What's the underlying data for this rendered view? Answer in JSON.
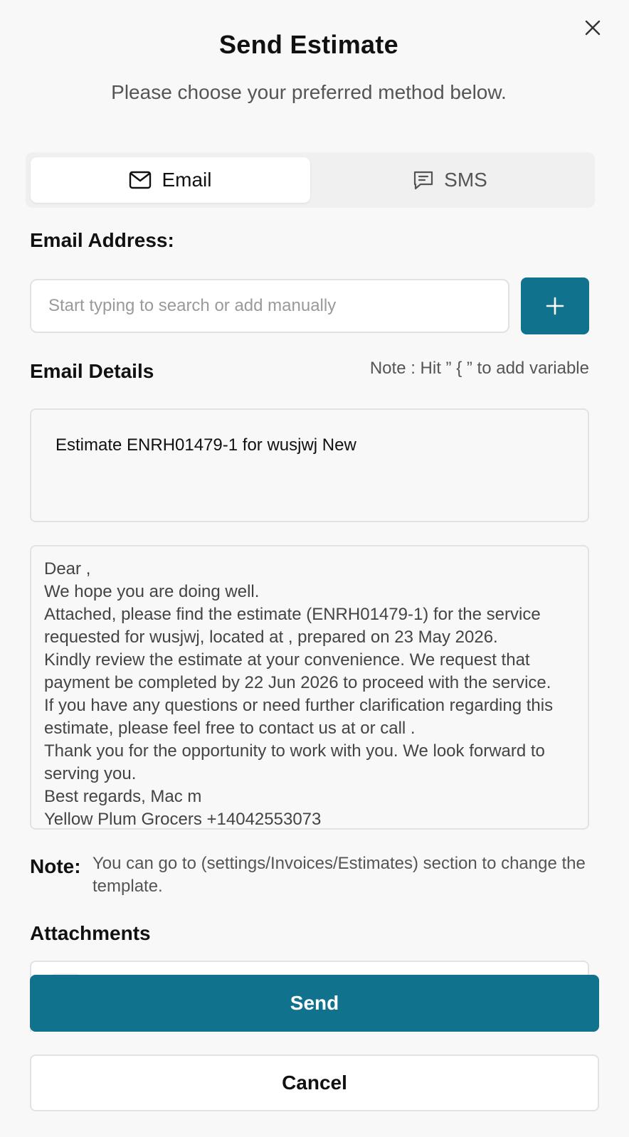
{
  "header": {
    "title": "Send Estimate",
    "subtitle": "Please choose your preferred method below."
  },
  "tabs": [
    {
      "label": "Email",
      "icon": "mail-icon",
      "active": true
    },
    {
      "label": "SMS",
      "icon": "message-icon",
      "active": false
    }
  ],
  "email": {
    "address_label": "Email Address:",
    "input_placeholder": "Start typing to search or add manually",
    "input_value": ""
  },
  "details": {
    "label": "Email Details",
    "variable_note": "Note : Hit ” { ” to add variable",
    "subject": "Estimate ENRH01479-1 for wusjwj New",
    "body_lines": [
      "Dear ,",
      "We hope you are doing well.",
      "Attached, please find the estimate (ENRH01479-1) for the service requested for wusjwj, located at , prepared on 23 May 2026.",
      "Kindly review the estimate at your convenience. We request that payment be completed by 22 Jun 2026 to proceed with the service.",
      "If you have any questions or need further clarification regarding this estimate, please feel free to contact us at or call .",
      "Thank you for the opportunity to work with you. We look forward to serving you.",
      "Best regards, Mac m",
      "Yellow Plum Grocers +14042553073"
    ]
  },
  "template_note": {
    "label": "Note:",
    "text": "You can go to (settings/Invoices/Estimates) section to change the template."
  },
  "attachments": {
    "label": "Attachments"
  },
  "actions": {
    "send_label": "Send",
    "cancel_label": "Cancel"
  },
  "colors": {
    "primary": "#10728c",
    "background": "#f8f8f8",
    "border": "#e2e2e2"
  }
}
